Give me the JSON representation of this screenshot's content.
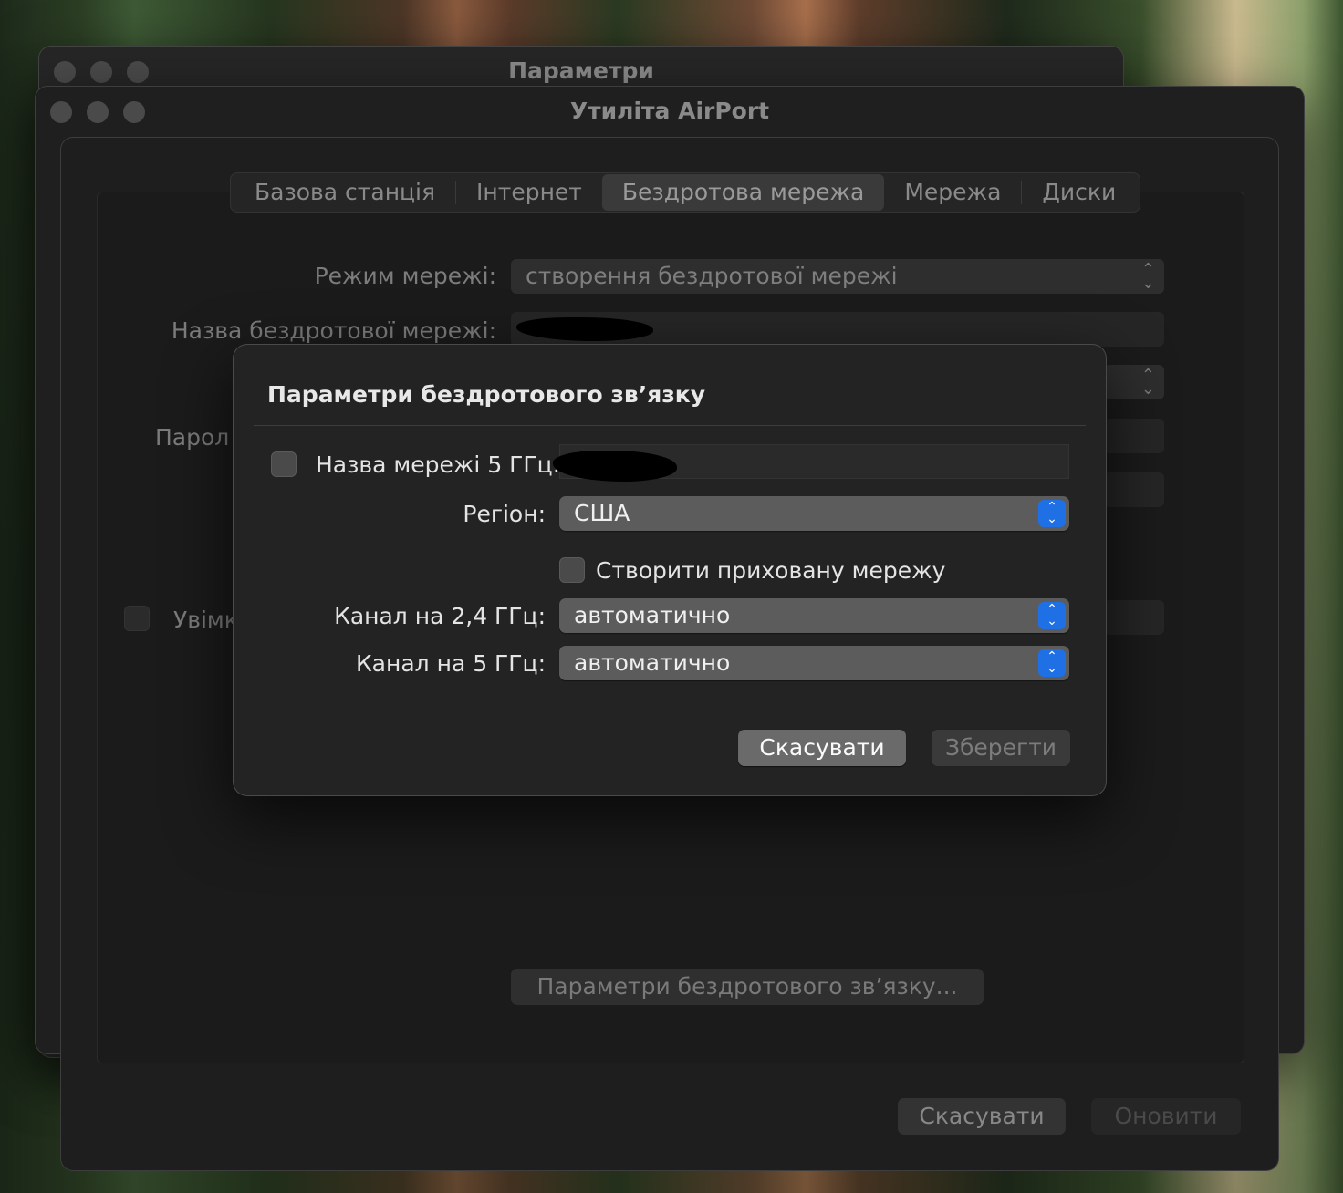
{
  "back_window": {
    "title": "Параметри"
  },
  "main_window": {
    "title": "Утиліта AirPort"
  },
  "tabs": [
    {
      "label": "Базова станція",
      "selected": false
    },
    {
      "label": "Інтернет",
      "selected": false
    },
    {
      "label": "Бездротова мережа",
      "selected": true
    },
    {
      "label": "Мережа",
      "selected": false
    },
    {
      "label": "Диски",
      "selected": false
    }
  ],
  "form": {
    "network_mode_label": "Режим мережі:",
    "network_mode_value": "створення бездротової мережі",
    "network_name_label": "Назва бездротової мережі:",
    "password_label_partial": "Парол",
    "enable_label_partial": "Увімк",
    "wireless_options_button": "Параметри бездротового зв’язку..."
  },
  "footer": {
    "cancel_label": "Скасувати",
    "update_label": "Оновити"
  },
  "dialog": {
    "title": "Параметри бездротового зв’язку",
    "network_5ghz_label": "Назва мережі 5 ГГц:",
    "network_5ghz_checked": false,
    "region_label": "Регіон:",
    "region_value": "США",
    "hidden_network_label": "Створити приховану мережу",
    "hidden_network_checked": false,
    "channel_24_label": "Канал на 2,4 ГГц:",
    "channel_24_value": "автоматично",
    "channel_5_label": "Канал на 5 ГГц:",
    "channel_5_value": "автоматично",
    "cancel_label": "Скасувати",
    "save_label": "Зберегти"
  },
  "colors": {
    "accent": "#1f6fe5"
  }
}
